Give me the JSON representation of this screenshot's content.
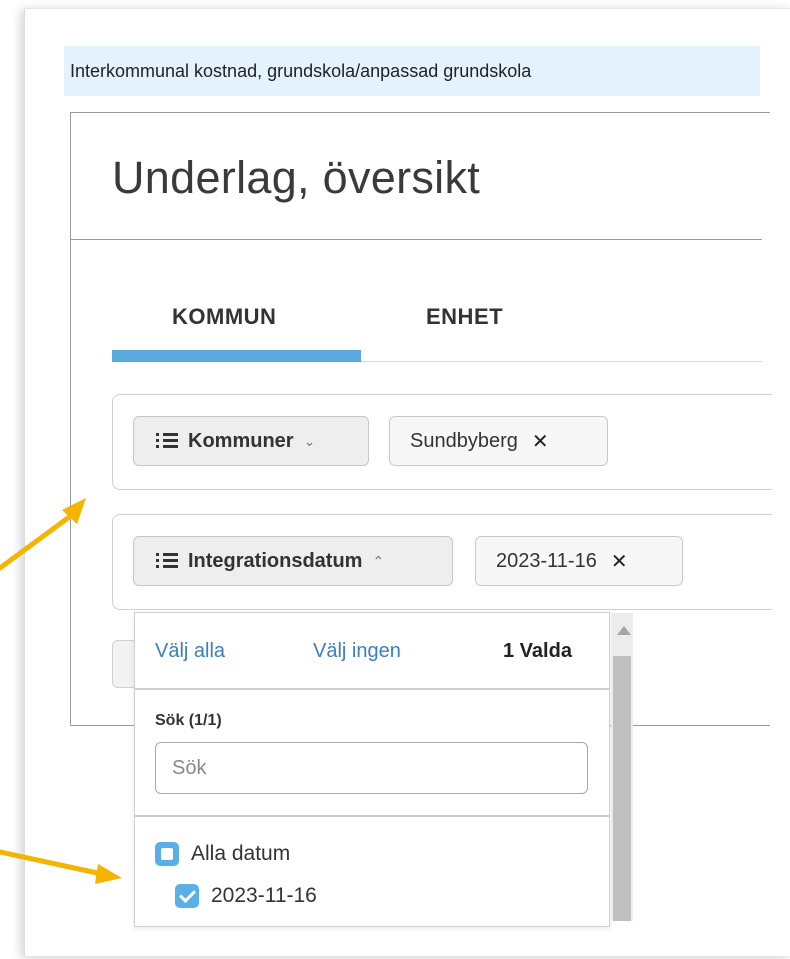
{
  "banner": {
    "text": "Interkommunal kostnad, grundskola/anpassad grundskola"
  },
  "panel": {
    "title": "Underlag, översikt"
  },
  "tabs": [
    {
      "label": "KOMMUN",
      "active": true
    },
    {
      "label": "ENHET",
      "active": false
    }
  ],
  "filters": {
    "kommuner": {
      "label": "Kommuner",
      "caret": "⌄",
      "chip": "Sundbyberg",
      "chip_remove": "✕"
    },
    "integrationsdatum": {
      "label": "Integrationsdatum",
      "caret": "⌃",
      "chip": "2023-11-16",
      "chip_remove": "✕"
    }
  },
  "popup": {
    "select_all": "Välj alla",
    "select_none": "Välj ingen",
    "count": "1 Valda",
    "search_label": "Sök (1/1)",
    "search_placeholder": "Sök",
    "options": [
      {
        "label": "Alla datum",
        "state": "partial"
      },
      {
        "label": "2023-11-16",
        "state": "checked"
      }
    ]
  },
  "colors": {
    "accent": "#5aa9df",
    "banner_bg": "#e3f2fc",
    "link": "#3a7fc1",
    "checkbox": "#5ab0e6",
    "annotation_arrow": "#f5b400"
  },
  "icons": [
    "list-icon",
    "chevron-down-icon",
    "chevron-up-icon",
    "close-icon",
    "checkbox-partial-icon",
    "checkbox-checked-icon",
    "scroll-up-icon",
    "annotation-arrow-icon"
  ]
}
